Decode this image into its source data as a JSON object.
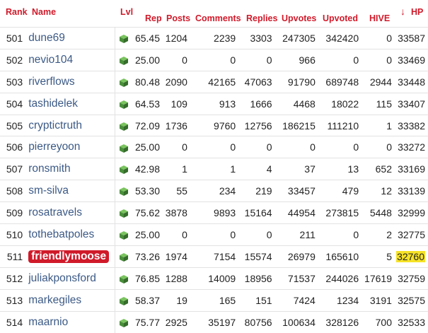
{
  "headers": {
    "rank": "Rank",
    "name": "Name",
    "lvl": "Lvl",
    "rep": "Rep",
    "posts": "Posts",
    "comments": "Comments",
    "replies": "Replies",
    "upvotes": "Upvotes",
    "upvoted": "Upvoted",
    "hive": "HIVE",
    "hp": "HP",
    "sort_arrow": "↓"
  },
  "colors": {
    "header_red": "#d01a2a",
    "name_blue": "#3c5a86",
    "highlight_name_bg": "#d01a2a",
    "highlight_hp_bg": "#f6e227",
    "level_icon_green": "#4a8f3b"
  },
  "level_icon": "green-cube-icon",
  "rows": [
    {
      "rank": "501",
      "name": "dune69",
      "rep": "65.45",
      "posts": "1204",
      "comments": "2239",
      "replies": "3303",
      "upvotes": "247305",
      "upvoted": "342420",
      "hive": "0",
      "hp": "33587"
    },
    {
      "rank": "502",
      "name": "nevio104",
      "rep": "25.00",
      "posts": "0",
      "comments": "0",
      "replies": "0",
      "upvotes": "966",
      "upvoted": "0",
      "hive": "0",
      "hp": "33469"
    },
    {
      "rank": "503",
      "name": "riverflows",
      "rep": "80.48",
      "posts": "2090",
      "comments": "42165",
      "replies": "47063",
      "upvotes": "91790",
      "upvoted": "689748",
      "hive": "2944",
      "hp": "33448"
    },
    {
      "rank": "504",
      "name": "tashidelek",
      "rep": "64.53",
      "posts": "109",
      "comments": "913",
      "replies": "1666",
      "upvotes": "4468",
      "upvoted": "18022",
      "hive": "115",
      "hp": "33407"
    },
    {
      "rank": "505",
      "name": "cryptictruth",
      "rep": "72.09",
      "posts": "1736",
      "comments": "9760",
      "replies": "12756",
      "upvotes": "186215",
      "upvoted": "111210",
      "hive": "1",
      "hp": "33382"
    },
    {
      "rank": "506",
      "name": "pierreyoon",
      "rep": "25.00",
      "posts": "0",
      "comments": "0",
      "replies": "0",
      "upvotes": "0",
      "upvoted": "0",
      "hive": "0",
      "hp": "33272"
    },
    {
      "rank": "507",
      "name": "ronsmith",
      "rep": "42.98",
      "posts": "1",
      "comments": "1",
      "replies": "4",
      "upvotes": "37",
      "upvoted": "13",
      "hive": "652",
      "hp": "33169"
    },
    {
      "rank": "508",
      "name": "sm-silva",
      "rep": "53.30",
      "posts": "55",
      "comments": "234",
      "replies": "219",
      "upvotes": "33457",
      "upvoted": "479",
      "hive": "12",
      "hp": "33139"
    },
    {
      "rank": "509",
      "name": "rosatravels",
      "rep": "75.62",
      "posts": "3878",
      "comments": "9893",
      "replies": "15164",
      "upvotes": "44954",
      "upvoted": "273815",
      "hive": "5448",
      "hp": "32999"
    },
    {
      "rank": "510",
      "name": "tothebatpoles",
      "rep": "25.00",
      "posts": "0",
      "comments": "0",
      "replies": "0",
      "upvotes": "211",
      "upvoted": "0",
      "hive": "2",
      "hp": "32775"
    },
    {
      "rank": "511",
      "name": "friendlymoose",
      "rep": "73.26",
      "posts": "1974",
      "comments": "7154",
      "replies": "15574",
      "upvotes": "26979",
      "upvoted": "165610",
      "hive": "5",
      "hp": "32760",
      "highlight": true
    },
    {
      "rank": "512",
      "name": "juliakponsford",
      "rep": "76.85",
      "posts": "1288",
      "comments": "14009",
      "replies": "18956",
      "upvotes": "71537",
      "upvoted": "244026",
      "hive": "17619",
      "hp": "32759"
    },
    {
      "rank": "513",
      "name": "markegiles",
      "rep": "58.37",
      "posts": "19",
      "comments": "165",
      "replies": "151",
      "upvotes": "7424",
      "upvoted": "1234",
      "hive": "3191",
      "hp": "32575"
    },
    {
      "rank": "514",
      "name": "maarnio",
      "rep": "75.77",
      "posts": "2925",
      "comments": "35197",
      "replies": "80756",
      "upvotes": "100634",
      "upvoted": "328126",
      "hive": "700",
      "hp": "32533"
    }
  ]
}
